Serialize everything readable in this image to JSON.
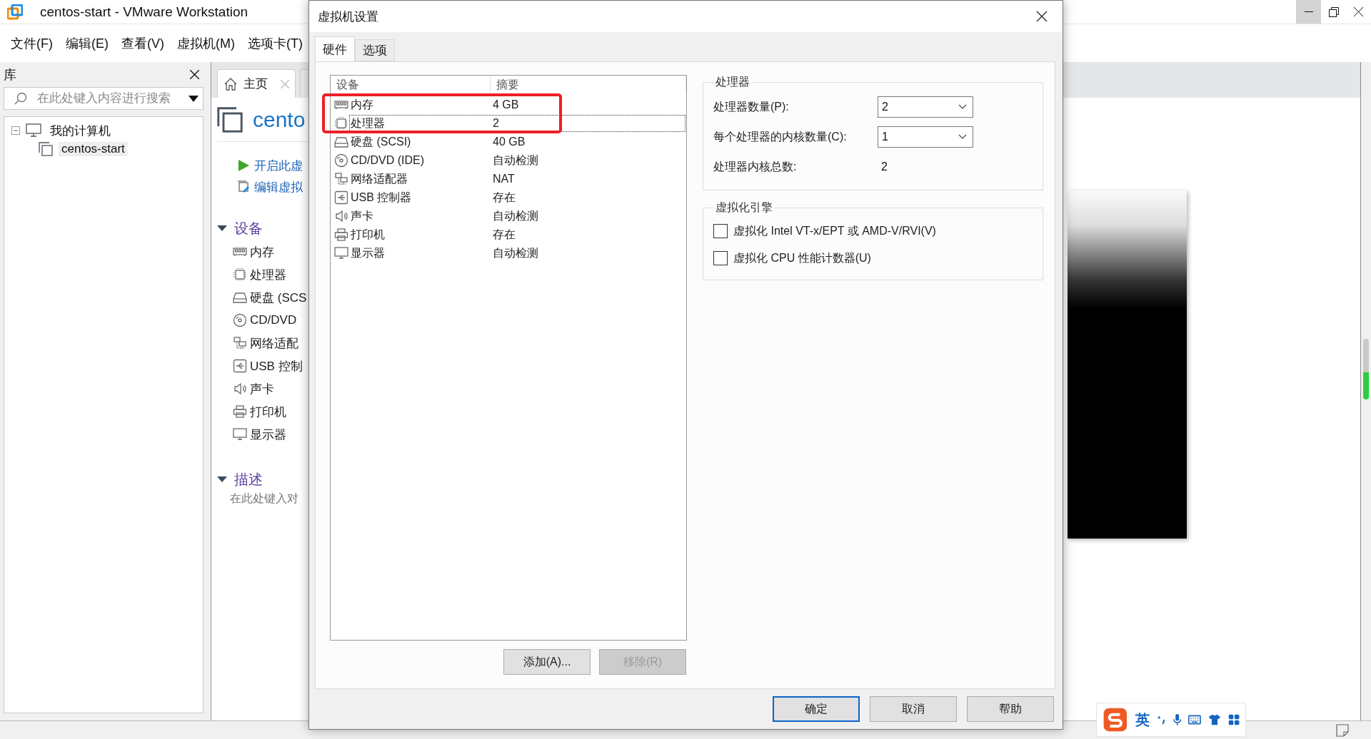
{
  "main_window": {
    "title": "centos-start - VMware Workstation",
    "menu": [
      "文件(F)",
      "编辑(E)",
      "查看(V)",
      "虚拟机(M)",
      "选项卡(T)"
    ]
  },
  "library": {
    "title": "库",
    "search": {
      "placeholder": "在此处键入内容进行搜索"
    },
    "tree": [
      {
        "label": "我的计算机",
        "expanded": true,
        "children": [
          {
            "label": "centos-start",
            "selected": true
          }
        ]
      }
    ]
  },
  "tabs": [
    {
      "label": "主页",
      "selected": true
    }
  ],
  "vm_panel": {
    "title": "cento",
    "actions": [
      {
        "kind": "power",
        "label": "开启此虚"
      },
      {
        "kind": "edit",
        "label": "编辑虚拟"
      }
    ],
    "devices_section": {
      "title": "设备",
      "expanded": true,
      "items": [
        {
          "kind": "memory",
          "label": "内存"
        },
        {
          "kind": "cpu",
          "label": "处理器"
        },
        {
          "kind": "disk",
          "label": "硬盘 (SCS"
        },
        {
          "kind": "cdrom",
          "label": "CD/DVD"
        },
        {
          "kind": "network",
          "label": "网络适配"
        },
        {
          "kind": "usb",
          "label": "USB 控制"
        },
        {
          "kind": "sound",
          "label": "声卡"
        },
        {
          "kind": "printer",
          "label": "打印机"
        },
        {
          "kind": "display",
          "label": "显示器"
        }
      ]
    },
    "description_section": {
      "title": "描述",
      "expanded": true,
      "text": "在此处键入对"
    }
  },
  "dialog": {
    "title": "虚拟机设置",
    "tabs": [
      {
        "label": "硬件",
        "selected": true
      },
      {
        "label": "选项",
        "selected": false
      }
    ],
    "hardware_table": {
      "columns": [
        "设备",
        "摘要"
      ],
      "rows": [
        {
          "kind": "memory",
          "device": "内存",
          "summary": "4 GB",
          "selected": false
        },
        {
          "kind": "cpu",
          "device": "处理器",
          "summary": "2",
          "selected": true
        },
        {
          "kind": "disk",
          "device": "硬盘 (SCSI)",
          "summary": "40 GB",
          "selected": false
        },
        {
          "kind": "cdrom",
          "device": "CD/DVD (IDE)",
          "summary": "自动检测",
          "selected": false
        },
        {
          "kind": "network",
          "device": "网络适配器",
          "summary": "NAT",
          "selected": false
        },
        {
          "kind": "usb",
          "device": "USB 控制器",
          "summary": "存在",
          "selected": false
        },
        {
          "kind": "sound",
          "device": "声卡",
          "summary": "自动检测",
          "selected": false
        },
        {
          "kind": "printer",
          "device": "打印机",
          "summary": "存在",
          "selected": false
        },
        {
          "kind": "display",
          "device": "显示器",
          "summary": "自动检测",
          "selected": false
        }
      ]
    },
    "list_buttons": [
      {
        "label": "添加(A)...",
        "disabled": false
      },
      {
        "label": "移除(R)",
        "disabled": true
      }
    ],
    "processor_group": {
      "title": "处理器",
      "fields": [
        {
          "kind": "dropdown",
          "label": "处理器数量(P):",
          "value": "2"
        },
        {
          "kind": "dropdown",
          "label": "每个处理器的内核数量(C):",
          "value": "1"
        },
        {
          "kind": "readout",
          "label": "处理器内核总数:",
          "value": "2"
        }
      ]
    },
    "virtualization_group": {
      "title": "虚拟化引擎",
      "options": [
        {
          "label": "虚拟化 Intel VT-x/EPT 或 AMD-V/RVI(V)",
          "checked": false
        },
        {
          "label": "虚拟化 CPU 性能计数器(U)",
          "checked": false
        }
      ]
    },
    "buttons": [
      {
        "label": "确定",
        "default": true
      },
      {
        "label": "取消",
        "default": false
      },
      {
        "label": "帮助",
        "default": false
      }
    ]
  },
  "ime_toolbar": {
    "mode": "英"
  }
}
